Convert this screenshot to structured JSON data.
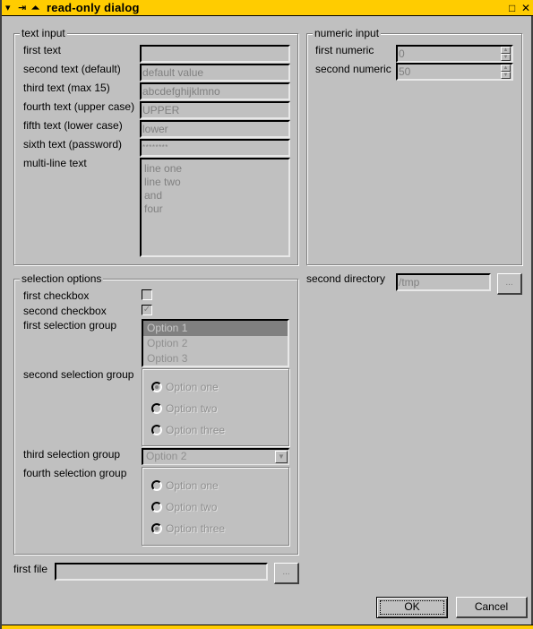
{
  "window": {
    "title": "read-only dialog",
    "title_bar_color": "#ffcc00",
    "controls_left": [
      "menu-icon",
      "pin-icon",
      "shade-icon"
    ],
    "controls_right": [
      "maximize-icon",
      "close-icon"
    ]
  },
  "text_input": {
    "group_title": "text input",
    "fields": [
      {
        "label": "first text",
        "value": ""
      },
      {
        "label": "second text (default)",
        "value": "default value"
      },
      {
        "label": "third text (max 15)",
        "value": "abcdefghijklmno"
      },
      {
        "label": "fourth text (upper case)",
        "value": "UPPER"
      },
      {
        "label": "fifth text (lower case)",
        "value": "lower"
      },
      {
        "label": "sixth text (password)",
        "value": "********"
      }
    ],
    "multiline": {
      "label": "multi-line text",
      "lines": [
        "line one",
        "line two",
        "and",
        "four"
      ]
    }
  },
  "numeric_input": {
    "group_title": "numeric input",
    "fields": [
      {
        "label": "first numeric",
        "value": "0"
      },
      {
        "label": "second numeric",
        "value": "50"
      }
    ]
  },
  "selection_options": {
    "group_title": "selection options",
    "checkboxes": [
      {
        "label": "first checkbox",
        "checked": false
      },
      {
        "label": "second checkbox",
        "checked": true,
        "mark": "✓"
      }
    ],
    "first_group": {
      "label": "first selection group",
      "options": [
        "Option 1",
        "Option 2",
        "Option 3"
      ],
      "selected": "Option 1"
    },
    "second_group": {
      "label": "second selection group",
      "options": [
        "Option one",
        "Option two",
        "Option three"
      ],
      "selected": "Option one"
    },
    "third_group": {
      "label": "third selection group",
      "value": "Option 2"
    },
    "fourth_group": {
      "label": "fourth selection group",
      "options": [
        "Option one",
        "Option two",
        "Option three"
      ],
      "selected": "Option three"
    }
  },
  "second_directory": {
    "label": "second directory",
    "value": "/tmp",
    "browse_label": "..."
  },
  "first_file": {
    "label": "first file",
    "value": "",
    "browse_label": "..."
  },
  "buttons": {
    "ok": "OK",
    "cancel": "Cancel"
  },
  "icons": {
    "menu": "▾",
    "pin": "⇥",
    "shade": "⏶",
    "maximize": "□",
    "close": "✕",
    "spin_up": "▲",
    "spin_down": "▼",
    "combo_arrow": "▼"
  }
}
